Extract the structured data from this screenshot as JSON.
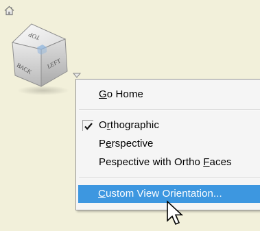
{
  "viewcube": {
    "faces": {
      "top": "TOP",
      "back": "BACK",
      "left": "LEFT"
    }
  },
  "menu": {
    "items": [
      {
        "id": "go-home",
        "label_pre": "",
        "mnemonic": "G",
        "label_post": "o Home",
        "checked": false,
        "highlighted": false
      },
      {
        "id": "orthographic",
        "label_pre": "O",
        "mnemonic": "r",
        "label_post": "thographic",
        "checked": true,
        "highlighted": false
      },
      {
        "id": "perspective",
        "label_pre": "P",
        "mnemonic": "e",
        "label_post": "rspective",
        "checked": false,
        "highlighted": false
      },
      {
        "id": "perspective-ortho-faces",
        "label_pre": "Pespective with Ortho ",
        "mnemonic": "F",
        "label_post": "aces",
        "checked": false,
        "highlighted": false
      },
      {
        "id": "custom-view-orientation",
        "label_pre": "",
        "mnemonic": "C",
        "label_post": "ustom View Orientation...",
        "checked": false,
        "highlighted": true
      }
    ]
  },
  "colors": {
    "background": "#f2f0da",
    "menu_background": "#f5f5f5",
    "highlight": "#3d97e0",
    "highlight_text": "#ffffff"
  },
  "icons": {
    "home": "home-icon",
    "menu_arrow": "dropdown-triangle-icon",
    "check": "checkmark-icon",
    "cursor": "mouse-pointer-icon"
  }
}
